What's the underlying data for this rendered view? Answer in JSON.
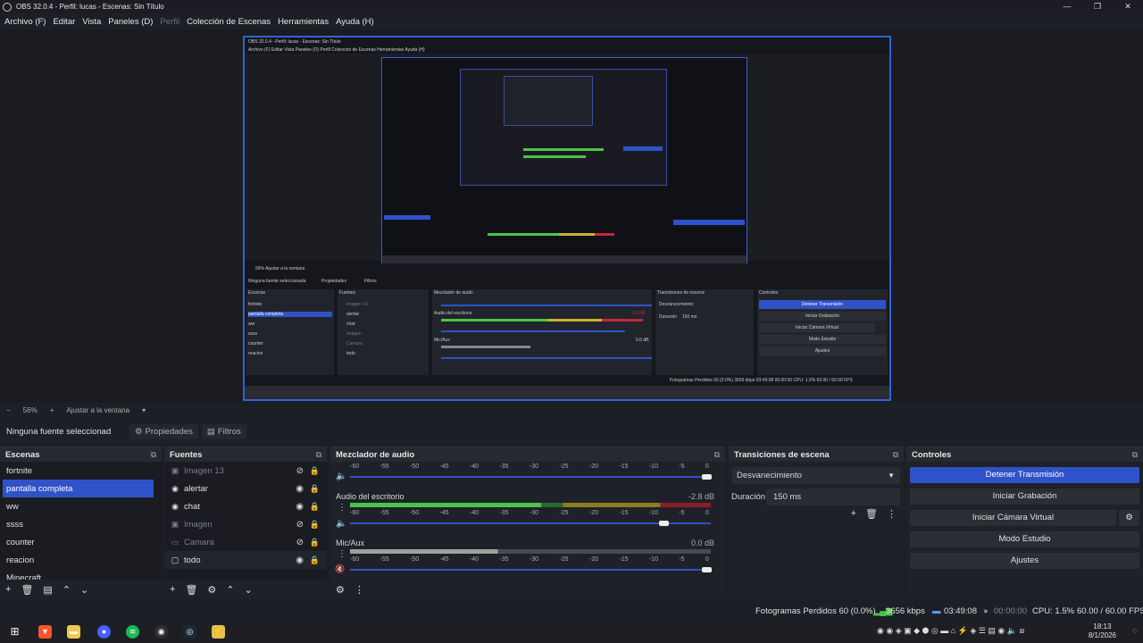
{
  "window": {
    "title": "OBS 32.0.4 - Perfil: lucas - Escenas: Sin Título",
    "minimize": "—",
    "maximize": "❐",
    "close": "✕"
  },
  "menu": [
    "Archivo (F)",
    "Editar",
    "Vista",
    "Paneles (D)",
    "Perfil",
    "Colección de Escenas",
    "Herramientas",
    "Ayuda (H)"
  ],
  "preview_mini": {
    "title": "OBS 32.0.4 - Perfil: lucas - Escenas: Sin Título",
    "menu": "Archivo (F)   Editar   Vista   Paneles (D)   Perfil   Colección de Escenas   Herramientas   Ayuda (H)",
    "zoom": "56%     Ajustar a la ventana",
    "no_source": "Ninguna fuente seleccionada",
    "properties": "Propiedades",
    "filters": "Filtros",
    "scenes_header": "Escenas",
    "sources_header": "Fuentes",
    "mixer_header": "Mezclador de audio",
    "transitions_header": "Transiciones de escena",
    "controls_header": "Controles",
    "scenes": [
      "fortnite",
      "pantalla completa",
      "ww",
      "ssss",
      "counter",
      "reacion",
      "minecraft"
    ],
    "sources": [
      "Imagen 13",
      "alertar",
      "chat",
      "Imagen",
      "Camara",
      "todo"
    ],
    "desktop_audio": "Audio del escritorio",
    "desktop_db": "-2.8 dB",
    "mic": "Mic/Aux",
    "mic_db": "0.0 dB",
    "transition": "Desvanecimiento",
    "duration_label": "Duración",
    "duration": "150 ms",
    "buttons": [
      "Detener Transmisión",
      "Iniciar Grabación",
      "Iniciar Cámara Virtual",
      "Modo Estudio",
      "Ajustes"
    ],
    "status": "Fotogramas Perdidos 60 (0.0%)   3656 kbps   03:49:08   00:00:00   CPU: 1.5%   60.00 / 60.00 FPS"
  },
  "zoom_bar": {
    "minus": "−",
    "zoom": "56%",
    "plus": "+",
    "fit": "Ajustar a la ventana",
    "dropdown": "▾"
  },
  "props_bar": {
    "no_source": "Ninguna fuente seleccionad",
    "properties": "Propiedades",
    "filters": "Filtros"
  },
  "scenes_dock": {
    "title": "Escenas",
    "items": [
      "fortnite",
      "pantalla completa",
      "ww",
      "ssss",
      "counter",
      "reacion",
      "Minecraft"
    ],
    "selected": 1
  },
  "sources_dock": {
    "title": "Fuentes",
    "items": [
      {
        "name": "Imagen 13",
        "visible": false,
        "icon": "image-icon"
      },
      {
        "name": "alertar",
        "visible": true,
        "icon": "browser-icon"
      },
      {
        "name": "chat",
        "visible": true,
        "icon": "browser-icon"
      },
      {
        "name": "Imagen",
        "visible": false,
        "icon": "image-icon"
      },
      {
        "name": "Camara",
        "visible": false,
        "icon": "camera-icon"
      },
      {
        "name": "todo",
        "visible": true,
        "icon": "display-capture-icon"
      }
    ]
  },
  "mixer": {
    "title": "Mezclador de audio",
    "ticks": [
      "-60",
      "-55",
      "-50",
      "-45",
      "-40",
      "-35",
      "-30",
      "-25",
      "-20",
      "-15",
      "-10",
      "-5",
      "0"
    ],
    "channels": [
      {
        "name": "",
        "db": "",
        "volume": 0.99
      },
      {
        "name": "Audio del escritorio",
        "db": "-2.8 dB",
        "volume": 0.86,
        "level": 0.86
      },
      {
        "name": "Mic/Aux",
        "db": "0.0 dB",
        "volume": 0.99,
        "level": 0.41,
        "muted": true
      }
    ]
  },
  "transitions": {
    "title": "Transiciones de escena",
    "selected": "Desvanecimiento",
    "duration_label": "Duración",
    "duration": "150 ms"
  },
  "controls": {
    "title": "Controles",
    "stop_stream": "Detener Transmisión",
    "start_recording": "Iniciar Grabación",
    "start_virtualcam": "Iniciar Cámara Virtual",
    "studio_mode": "Modo Estudio",
    "settings": "Ajustes"
  },
  "status": {
    "dropped_frames": "Fotogramas Perdidos 60 (0.0%)",
    "bitrate": "3656 kbps",
    "stream_time": "03:49:08",
    "record_time": "00:00:00",
    "cpu": "CPU: 1.5%",
    "fps": "60.00 / 60.00 FPS"
  },
  "taskbar": {
    "time": "18:13",
    "date": "8/1/2026"
  },
  "colors": {
    "accent": "#2f52c8",
    "meter_green": "#4cc34a",
    "meter_yellow": "#c9b42b",
    "meter_red": "#c3293a"
  }
}
